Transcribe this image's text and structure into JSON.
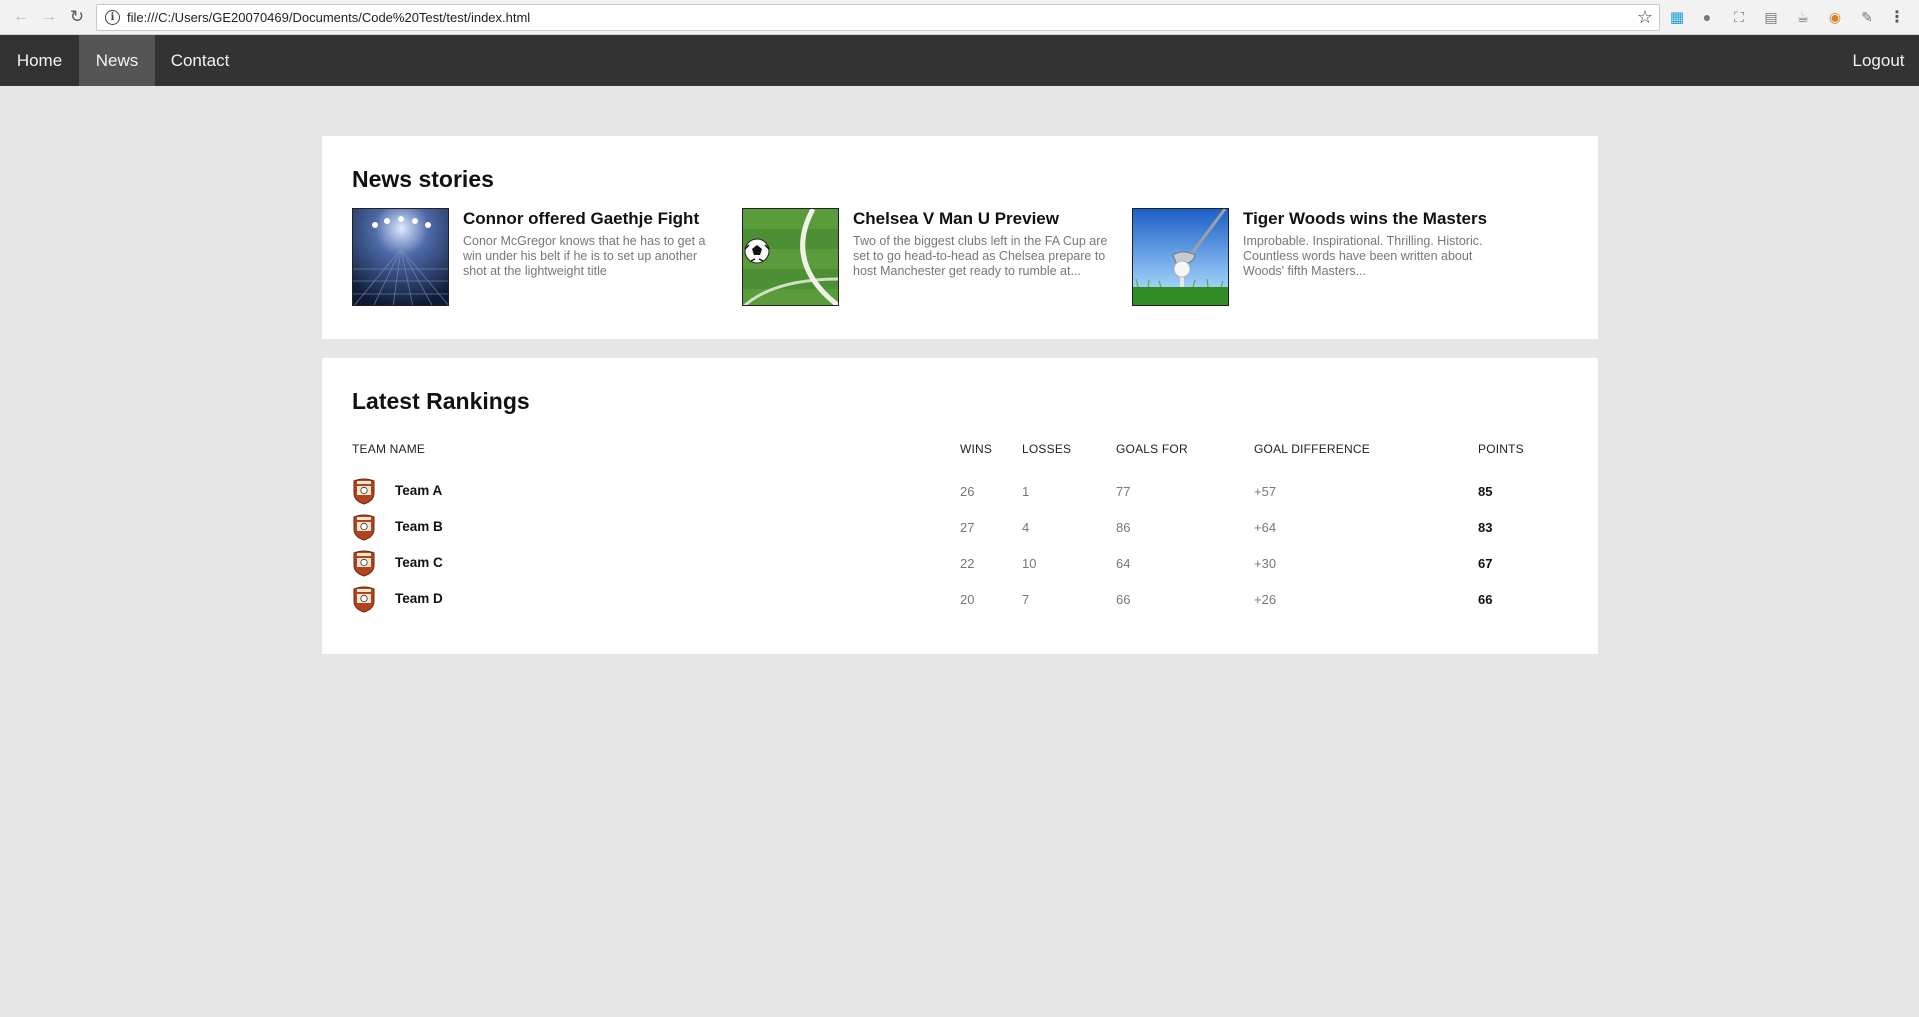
{
  "browser": {
    "url": "file:///C:/Users/GE20070469/Documents/Code%20Test/test/index.html"
  },
  "navbar": {
    "links": [
      "Home",
      "News",
      "Contact"
    ],
    "active": "News",
    "logout": "Logout"
  },
  "news": {
    "title": "News stories",
    "stories": [
      {
        "headline": "Connor offered Gaethje Fight",
        "summary": "Conor McGregor knows that he has to get a win under his belt if he is to set up another shot at the lightweight title",
        "image": "stadium-lights-cage"
      },
      {
        "headline": "Chelsea V Man U Preview",
        "summary": "Two of the biggest clubs left in the FA Cup are set to go head-to-head as Chelsea prepare to host Manchester get ready to rumble at...",
        "image": "football-on-pitch"
      },
      {
        "headline": "Tiger Woods wins the Masters",
        "summary": "Improbable. Inspirational. Thrilling. Historic. Countless words have been written about Woods' fifth Masters...",
        "image": "golf-ball-and-club"
      }
    ]
  },
  "rankings": {
    "title": "Latest Rankings",
    "columns": [
      "TEAM NAME",
      "WINS",
      "LOSSES",
      "GOALS FOR",
      "GOAL DIFFERENCE",
      "POINTS"
    ],
    "rows": [
      {
        "team": "Team A",
        "wins": "26",
        "losses": "1",
        "goals_for": "77",
        "goal_difference": "+57",
        "points": "85"
      },
      {
        "team": "Team B",
        "wins": "27",
        "losses": "4",
        "goals_for": "86",
        "goal_difference": "+64",
        "points": "83"
      },
      {
        "team": "Team C",
        "wins": "22",
        "losses": "10",
        "goals_for": "64",
        "goal_difference": "+30",
        "points": "67"
      },
      {
        "team": "Team D",
        "wins": "20",
        "losses": "7",
        "goals_for": "66",
        "goal_difference": "+26",
        "points": "66"
      }
    ]
  }
}
